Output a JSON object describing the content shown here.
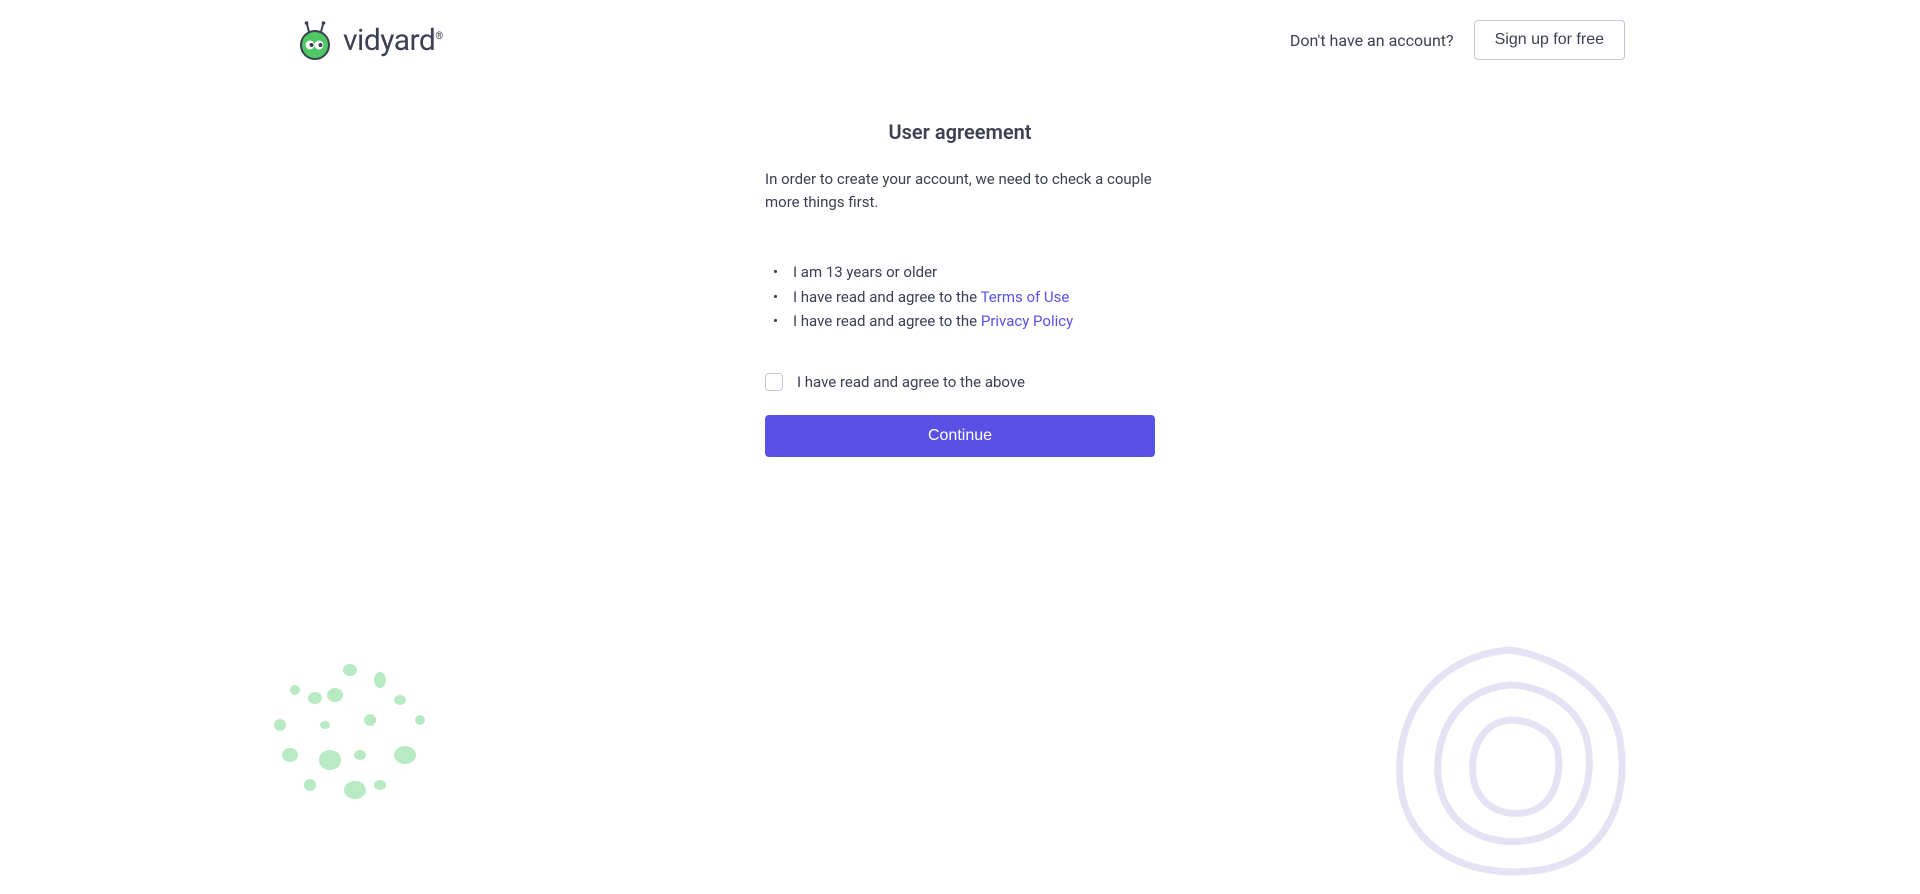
{
  "header": {
    "brand": "vidyard",
    "no_account_text": "Don't have an account?",
    "signup_label": "Sign up for free"
  },
  "page": {
    "title": "User agreement",
    "intro": "In order to create your account, we need to check a couple more things first.",
    "terms": [
      {
        "prefix": "I am 13 years or older",
        "link": null
      },
      {
        "prefix": "I have read and agree to the ",
        "link": "Terms of Use"
      },
      {
        "prefix": "I have read and agree to the ",
        "link": "Privacy Policy"
      }
    ],
    "checkbox_label": "I have read and agree to the above",
    "continue_label": "Continue"
  },
  "colors": {
    "primary": "#5951e5",
    "text": "#3b4052",
    "accent_green": "#4ec765",
    "deco_light": "#e4e3f4"
  }
}
